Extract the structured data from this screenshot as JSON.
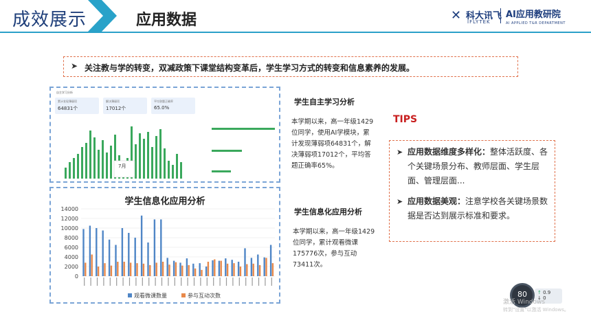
{
  "header": {
    "title": "成效展示",
    "subtitle": "应用数据",
    "logo1_cn": "科大讯飞",
    "logo1_en": "IFLYTEK",
    "logo2_cn": "AI应用教研院",
    "logo2_en": "AI APPLIED T&R DEPARTMENT",
    "accent": "#2aa0c8",
    "brand": "#1d3d7d"
  },
  "banner": {
    "text": "关注教与学的转变，双减政策下课堂结构变革后，学生学习方式的转变和信息素养的发展。"
  },
  "panel1": {
    "mini_title": "自主学习分析",
    "stats": [
      {
        "label": "累计发现薄弱项",
        "value": "64831个"
      },
      {
        "label": "解决薄弱项",
        "value": "17012个"
      },
      {
        "label": "平均答题正确率",
        "value": "65.0%"
      }
    ],
    "tooltip": "7月"
  },
  "panel2": {
    "chart_title": "学生信息化应用分析"
  },
  "chart_data": {
    "type": "bar",
    "title": "学生信息化应用分析",
    "ylim": [
      0,
      14000
    ],
    "yticks": [
      0,
      2000,
      4000,
      6000,
      8000,
      10000,
      12000,
      14000
    ],
    "grid": true,
    "legend_position": "bottom",
    "series": [
      {
        "name": "观看微课数量",
        "color": "#4f86c6",
        "values": [
          9800,
          10500,
          10000,
          9500,
          7600,
          6500,
          10000,
          9000,
          8000,
          12600,
          7000,
          11800,
          11800,
          3800,
          3200,
          2800,
          3700,
          2600,
          2700,
          2000,
          3300,
          3200,
          3700,
          3400,
          3000,
          5800,
          3800,
          4500,
          3900,
          6500
        ]
      },
      {
        "name": "参与互动次数",
        "color": "#e8894a",
        "values": [
          2800,
          4500,
          2000,
          2700,
          2200,
          3000,
          3000,
          2800,
          2700,
          2600,
          2300,
          2800,
          3000,
          2400,
          2900,
          2200,
          2300,
          1600,
          1300,
          3000,
          3500,
          3200,
          2600,
          2700,
          2000,
          2500,
          2600,
          2300,
          3800,
          2700
        ]
      }
    ]
  },
  "section1": {
    "title": "学生自主学习分析",
    "body": "本学期以来，高一年级1429位同学，使用AI学模块，累计发现薄弱项64831个，解决薄弱项17012个，平均答题正确率65%。"
  },
  "section2": {
    "title": "学生信息化应用分析",
    "body": "本学期以来，高一年级1429位同学，累计观看微课175776次，参与互动73411次。"
  },
  "tips": {
    "label": "TIPS",
    "color": "#c81e1e",
    "items": [
      {
        "heading": "应用数据维度多样化：",
        "text": "整体活跃度、各个关键场景分布、教师层面、学生层面、管理层面..."
      },
      {
        "heading": "应用数据美观：",
        "text": "注意学校各关键场景数据是否达到展示标准和要求。"
      }
    ]
  },
  "overlay": {
    "gauge_value": "80",
    "net_up": "0.9",
    "net_down": "0",
    "watermark1": "激活 Windows",
    "watermark2": "转到\"设置\"以激活 Windows。"
  }
}
